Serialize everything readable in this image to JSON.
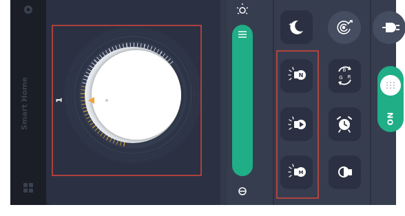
{
  "app": {
    "sidebar_title": "Smart Home",
    "dial_marker_label": "1"
  },
  "dial": {
    "scale_color": "#d3a33a",
    "knob_color": "#ffffff"
  },
  "slider": {
    "color": "#1fae86",
    "level": 1.0
  },
  "power_toggle": {
    "label": "ON",
    "state": true,
    "color": "#1fae86"
  },
  "icons": {
    "top": [
      "brightness-icon"
    ],
    "column1": [
      "moon-icon",
      "bulb-n-icon",
      "bulb-play-icon",
      "bulb-m-icon"
    ],
    "column2": [
      "target-icon",
      "rotate-icon",
      "timer-icon",
      "bulb-dark-icon"
    ],
    "column3": [
      "plug-icon"
    ]
  },
  "colors": {
    "panel": "#2b3142",
    "accent": "#1fae86",
    "highlight_border": "#d9463c"
  }
}
